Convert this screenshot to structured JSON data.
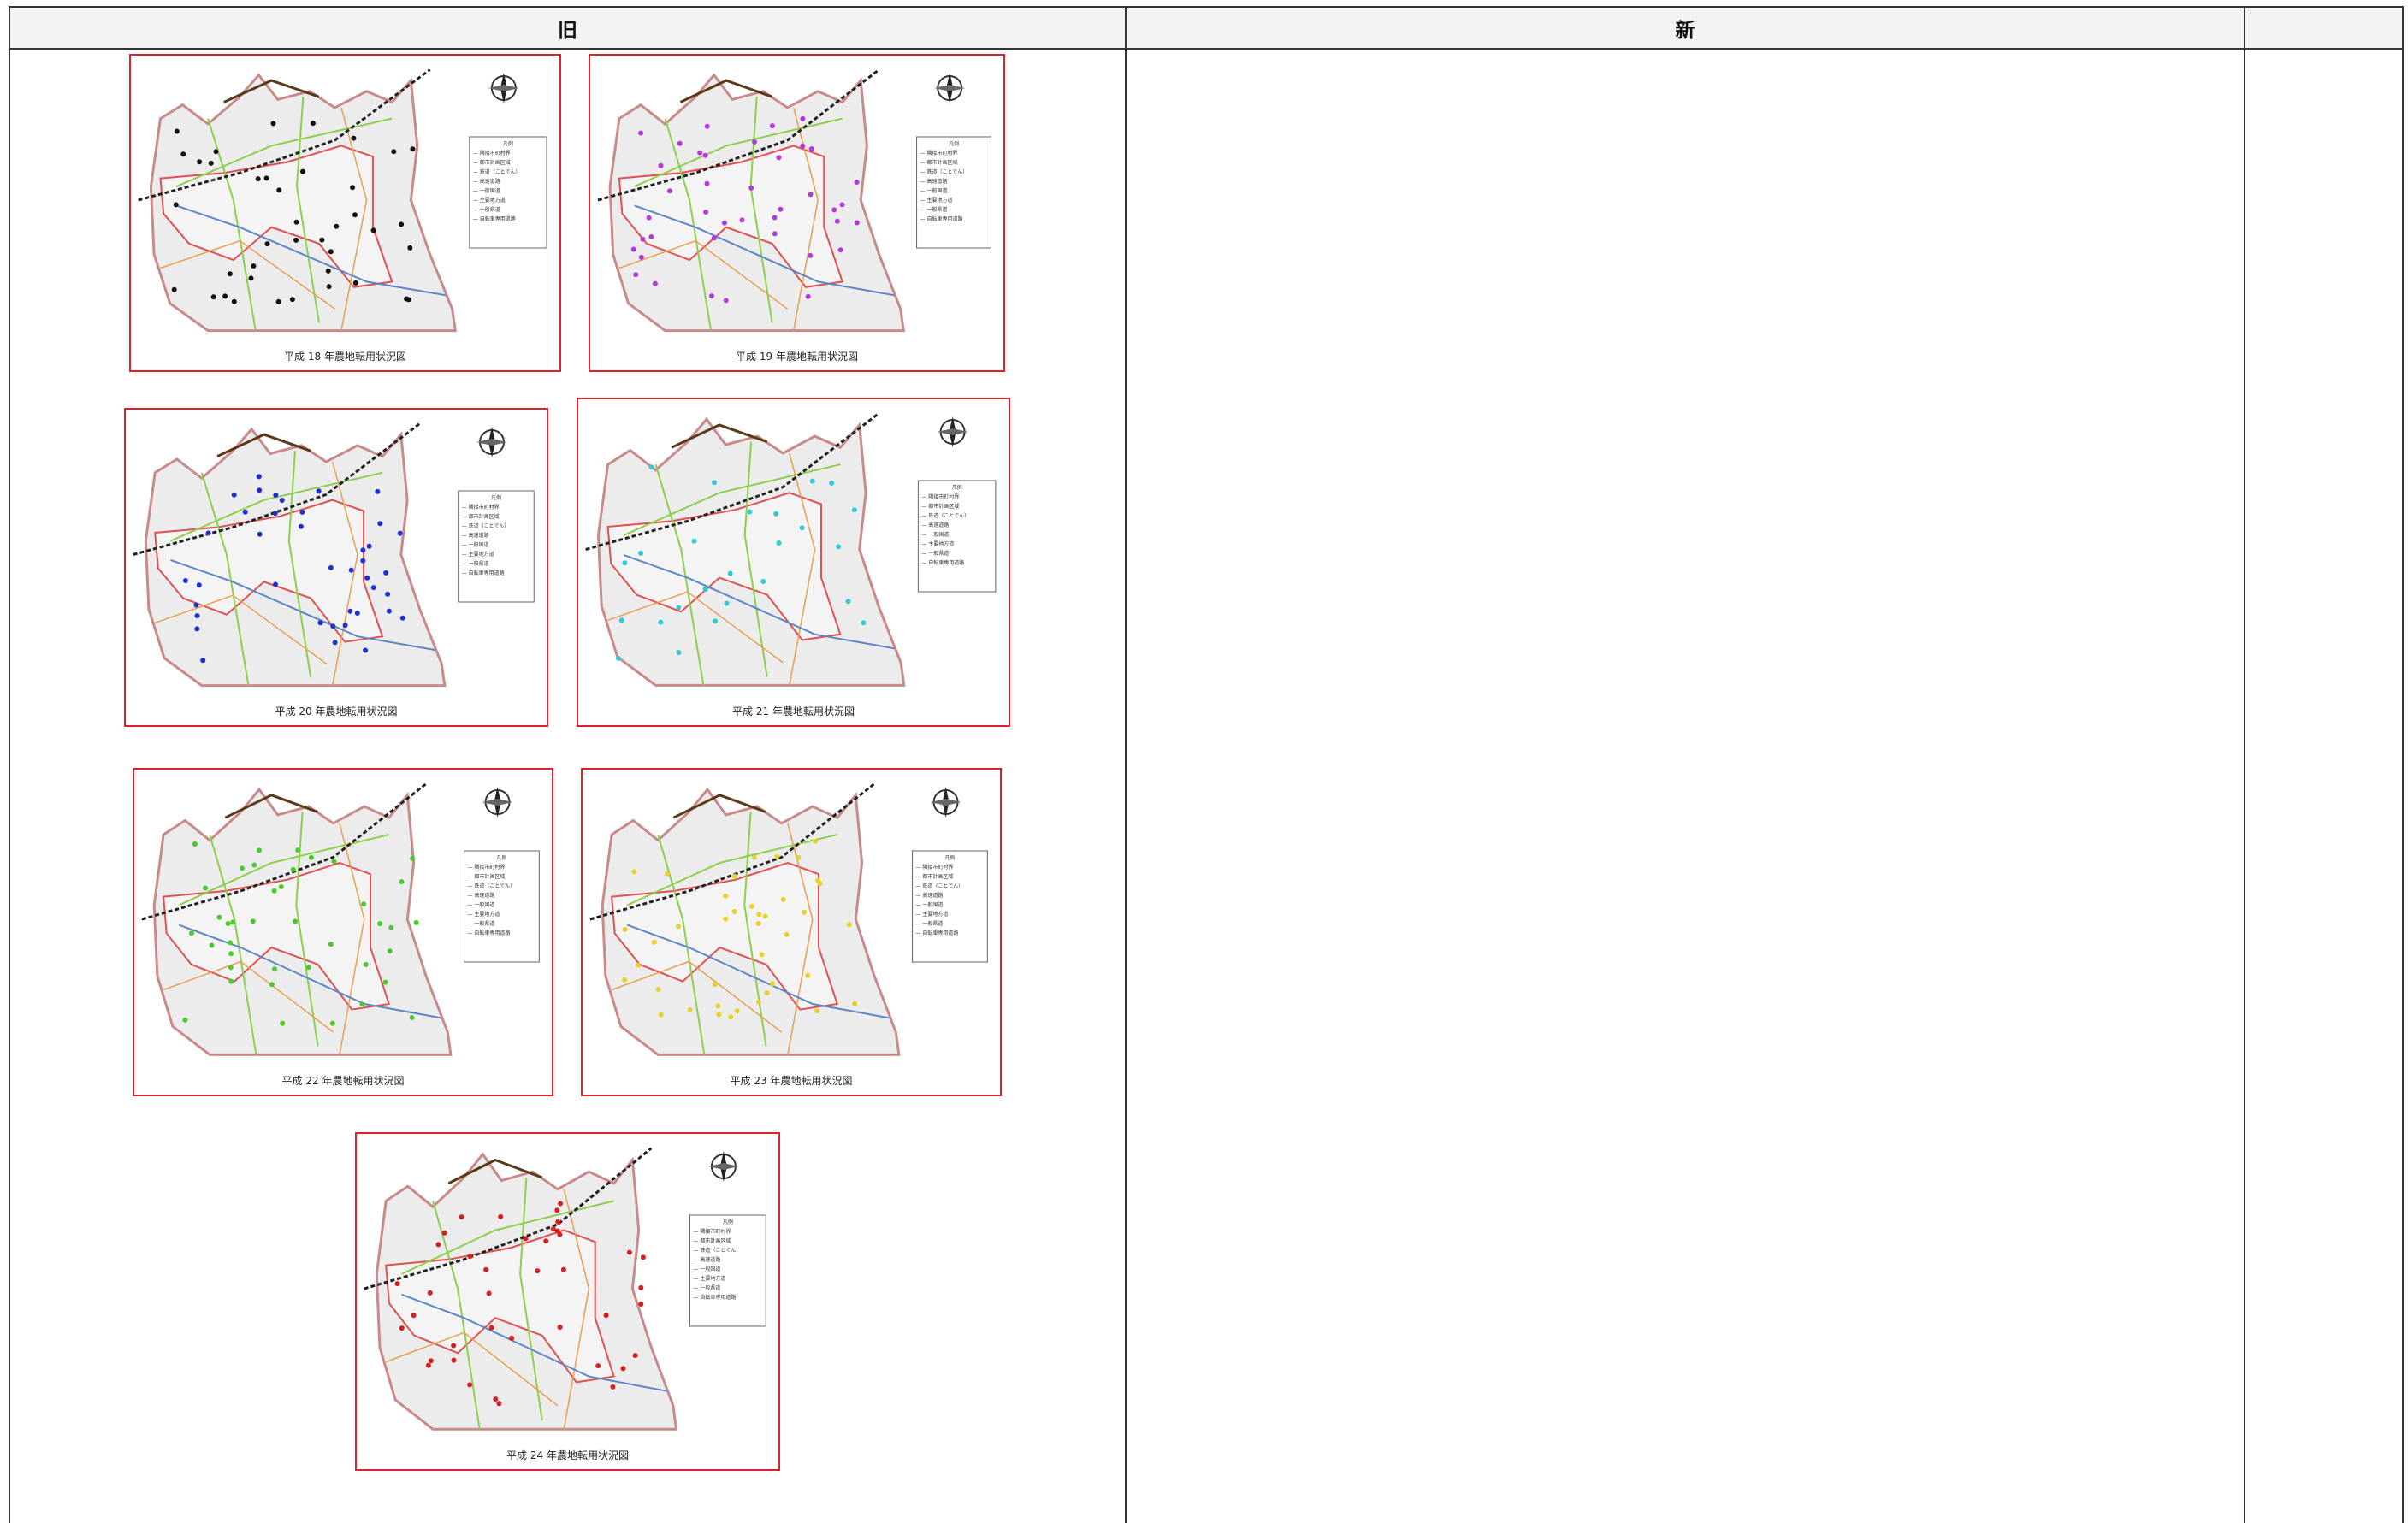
{
  "table": {
    "headers": {
      "old": "旧",
      "new": "新",
      "note": ""
    }
  },
  "maps": [
    {
      "caption": "平成 18 年農地転用状況図",
      "dot_color": "#111111"
    },
    {
      "caption": "平成 19 年農地転用状況図",
      "dot_color": "#b23bd8"
    },
    {
      "caption": "平成 20 年農地転用状況図",
      "dot_color": "#1f2fd0"
    },
    {
      "caption": "平成 21 年農地転用状況図",
      "dot_color": "#35c8d8"
    },
    {
      "caption": "平成 22 年農地転用状況図",
      "dot_color": "#4cc832"
    },
    {
      "caption": "平成 23 年農地転用状況図",
      "dot_color": "#e8d030"
    },
    {
      "caption": "平成 24 年農地転用状況図",
      "dot_color": "#d81e1e"
    }
  ],
  "legend": {
    "title": "凡例",
    "items": [
      "隣接市町村界",
      "都市計画区域",
      "鉄道（ことでん）",
      "高速道路",
      "一般国道",
      "主要地方道",
      "一般県道",
      "自転車専用道路"
    ]
  },
  "colors": {
    "frame": "#e0202a",
    "border": "#e05050",
    "river": "#5a86c8",
    "road_green": "#8ad04a",
    "road_orange": "#e8a050",
    "expressway": "#5a3a1a",
    "rail": "#222222"
  }
}
